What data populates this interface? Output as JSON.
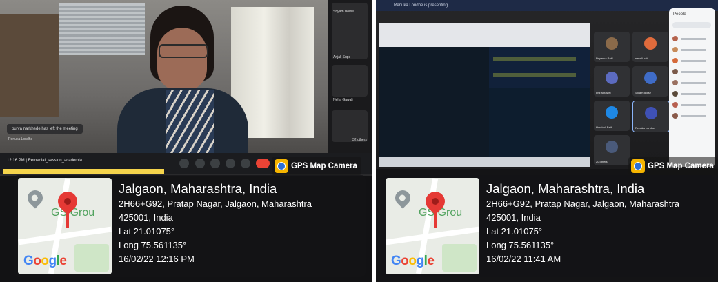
{
  "left": {
    "meeting_time": "12:16 PM",
    "meeting_name": "Remedial_session_academia",
    "notification": "purva narkhede has left the meeting",
    "presenter_label": "Renuka Londhe",
    "gallery": [
      {
        "name": "Shyam Borse"
      },
      {
        "name": "Anjali Supe"
      },
      {
        "name": "Neha Gawali"
      },
      {
        "name": "32 others"
      }
    ],
    "gps": {
      "badge": "GPS Map Camera",
      "place": "Jalgaon, Maharashtra, India",
      "address_line1": "2H66+G92, Pratap Nagar, Jalgaon, Maharashtra",
      "address_line2": "425001, India",
      "lat": "Lat 21.01075°",
      "long": "Long 75.561135°",
      "datetime": "16/02/22 12:16 PM",
      "map_label": "GS Grou",
      "google": "Google"
    }
  },
  "right": {
    "presenting_banner": "Renuka Londhe is presenting",
    "participants": [
      {
        "name": "Priyanka Patil",
        "color": "#8a6a4a"
      },
      {
        "name": "manali patil",
        "color": "#e06b3c"
      },
      {
        "name": "priti agrawal",
        "color": "#5c6bc0"
      },
      {
        "name": "Shyam Borse",
        "color": "#3f6cc7"
      },
      {
        "name": "Harshali Patil",
        "color": "#1e88e5"
      },
      {
        "name": "Renuka Londhe",
        "color": "#3f51b5"
      },
      {
        "name": "20 others",
        "color": "#4a5a7a"
      }
    ],
    "people_panel_title": "People",
    "gps": {
      "badge": "GPS Map Camera",
      "place": "Jalgaon, Maharashtra, India",
      "address_line1": "2H66+G92, Pratap Nagar, Jalgaon, Maharashtra",
      "address_line2": "425001, India",
      "lat": "Lat 21.01075°",
      "long": "Long 75.561135°",
      "datetime": "16/02/22 11:41 AM",
      "map_label": "GS Grou",
      "google": "Google"
    }
  }
}
